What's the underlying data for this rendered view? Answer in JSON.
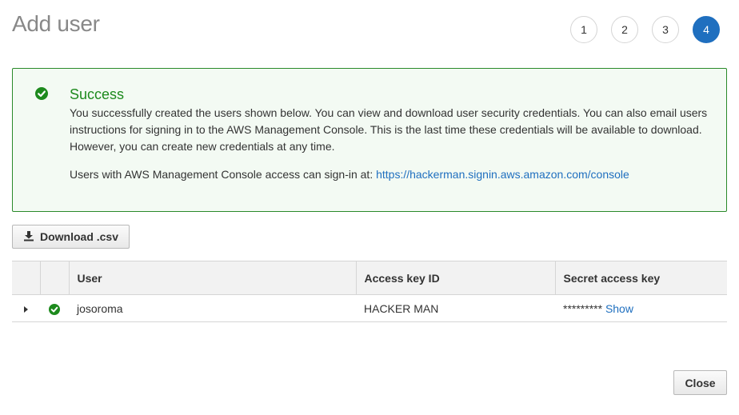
{
  "page": {
    "title": "Add user"
  },
  "steps": [
    {
      "label": "1",
      "active": false
    },
    {
      "label": "2",
      "active": false
    },
    {
      "label": "3",
      "active": false
    },
    {
      "label": "4",
      "active": true
    }
  ],
  "alert": {
    "icon": "success-check-icon",
    "title": "Success",
    "body": "You successfully created the users shown below. You can view and download user security credentials. You can also email users instructions for signing in to the AWS Management Console. This is the last time these credentials will be available to download. However, you can create new credentials at any time.",
    "signin_prefix": "Users with AWS Management Console access can sign-in at: ",
    "signin_url": "https://hackerman.signin.aws.amazon.com/console"
  },
  "actions": {
    "download_label": "Download .csv",
    "download_icon": "download-icon",
    "close_label": "Close"
  },
  "table": {
    "headers": {
      "user": "User",
      "access_key_id": "Access key ID",
      "secret_access_key": "Secret access key"
    },
    "rows": [
      {
        "user": "josoroma",
        "access_key_id": "HACKER MAN",
        "secret_masked": "*********",
        "secret_show_label": "Show"
      }
    ]
  },
  "colors": {
    "accent": "#1f6fbf",
    "success": "#1d8a1d",
    "success_bg": "#f3faf3"
  }
}
